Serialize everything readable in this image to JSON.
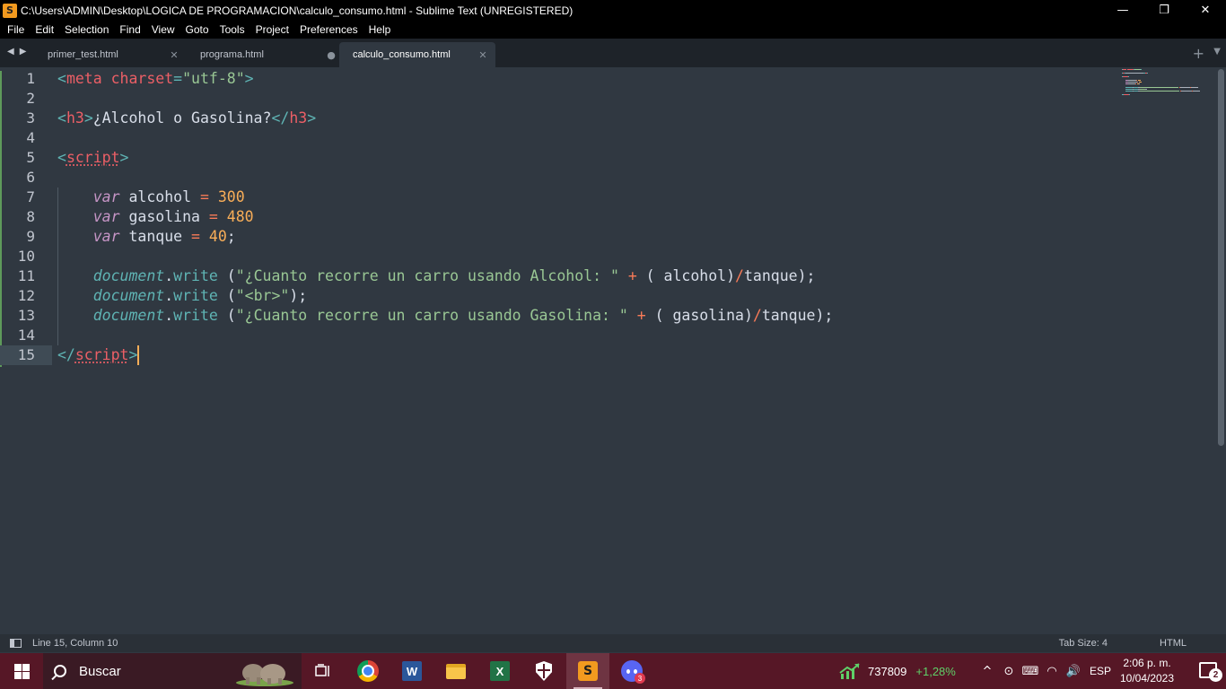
{
  "window": {
    "title": "C:\\Users\\ADMIN\\Desktop\\LOGICA DE PROGRAMACION\\calculo_consumo.html - Sublime Text (UNREGISTERED)",
    "controls": {
      "minimize": "—",
      "maximize": "❐",
      "close": "✕"
    }
  },
  "menu": [
    "File",
    "Edit",
    "Selection",
    "Find",
    "View",
    "Goto",
    "Tools",
    "Project",
    "Preferences",
    "Help"
  ],
  "tabs": [
    {
      "label": "primer_test.html",
      "state": "close"
    },
    {
      "label": "programa.html",
      "state": "modified"
    },
    {
      "label": "calculo_consumo.html",
      "state": "active"
    }
  ],
  "tabbar": {
    "back": "◀",
    "forward": "▶",
    "new_tab": "+",
    "more": "▼"
  },
  "tab_controls": {
    "close": "✕",
    "modified": "●"
  },
  "editor": {
    "line_numbers": [
      "1",
      "2",
      "3",
      "4",
      "5",
      "6",
      "7",
      "8",
      "9",
      "10",
      "11",
      "12",
      "13",
      "14",
      "15"
    ],
    "current_line": 15,
    "lines": [
      [
        [
          "tk-punc",
          "<"
        ],
        [
          "tk-tag",
          "meta"
        ],
        [
          "tk-text",
          " "
        ],
        [
          "tk-attr",
          "charset"
        ],
        [
          "tk-punc",
          "="
        ],
        [
          "tk-str",
          "\"utf-8\""
        ],
        [
          "tk-punc",
          ">"
        ]
      ],
      [],
      [
        [
          "tk-punc",
          "<"
        ],
        [
          "tk-tag",
          "h3"
        ],
        [
          "tk-punc",
          ">"
        ],
        [
          "tk-text",
          "¿Alcohol o Gasolina?"
        ],
        [
          "tk-punc",
          "</"
        ],
        [
          "tk-tag",
          "h3"
        ],
        [
          "tk-punc",
          ">"
        ]
      ],
      [],
      [
        [
          "tk-punc",
          "<"
        ],
        [
          "tk-tag ul",
          "script"
        ],
        [
          "tk-punc",
          ">"
        ]
      ],
      [],
      [
        [
          "tk-text",
          "    "
        ],
        [
          "tk-kw",
          "var"
        ],
        [
          "tk-text",
          " alcohol "
        ],
        [
          "tk-op",
          "="
        ],
        [
          "tk-text",
          " "
        ],
        [
          "tk-num",
          "300"
        ]
      ],
      [
        [
          "tk-text",
          "    "
        ],
        [
          "tk-kw",
          "var"
        ],
        [
          "tk-text",
          " gasolina "
        ],
        [
          "tk-op",
          "="
        ],
        [
          "tk-text",
          " "
        ],
        [
          "tk-num",
          "480"
        ]
      ],
      [
        [
          "tk-text",
          "    "
        ],
        [
          "tk-kw",
          "var"
        ],
        [
          "tk-text",
          " tanque "
        ],
        [
          "tk-op",
          "="
        ],
        [
          "tk-text",
          " "
        ],
        [
          "tk-num",
          "40"
        ],
        [
          "tk-text",
          ";"
        ]
      ],
      [],
      [
        [
          "tk-text",
          "    "
        ],
        [
          "tk-doc",
          "document"
        ],
        [
          "tk-text",
          "."
        ],
        [
          "tk-method",
          "write"
        ],
        [
          "tk-text",
          " ("
        ],
        [
          "tk-str",
          "\"¿Cuanto recorre un carro usando Alcohol: \""
        ],
        [
          "tk-text",
          " "
        ],
        [
          "tk-op",
          "+"
        ],
        [
          "tk-text",
          " ( alcohol)"
        ],
        [
          "tk-op",
          "/"
        ],
        [
          "tk-text",
          "tanque);"
        ]
      ],
      [
        [
          "tk-text",
          "    "
        ],
        [
          "tk-doc",
          "document"
        ],
        [
          "tk-text",
          "."
        ],
        [
          "tk-method",
          "write"
        ],
        [
          "tk-text",
          " ("
        ],
        [
          "tk-str",
          "\"<br>\""
        ],
        [
          "tk-text",
          ");"
        ]
      ],
      [
        [
          "tk-text",
          "    "
        ],
        [
          "tk-doc",
          "document"
        ],
        [
          "tk-text",
          "."
        ],
        [
          "tk-method",
          "write"
        ],
        [
          "tk-text",
          " ("
        ],
        [
          "tk-str",
          "\"¿Cuanto recorre un carro usando Gasolina: \""
        ],
        [
          "tk-text",
          " "
        ],
        [
          "tk-op",
          "+"
        ],
        [
          "tk-text",
          " ( gasolina)"
        ],
        [
          "tk-op",
          "/"
        ],
        [
          "tk-text",
          "tanque);"
        ]
      ],
      [],
      [
        [
          "tk-punc",
          "</"
        ],
        [
          "tk-tag ul",
          "script"
        ],
        [
          "tk-punc",
          ">"
        ]
      ]
    ]
  },
  "status": {
    "position": "Line 15, Column 10",
    "tab_size": "Tab Size: 4",
    "syntax": "HTML"
  },
  "taskbar": {
    "search_placeholder": "Buscar",
    "apps": [
      "task-view",
      "chrome",
      "word",
      "file-explorer",
      "excel",
      "security",
      "sublime-text",
      "discord"
    ],
    "discord_badge": "3",
    "word_letter": "W",
    "excel_letter": "X",
    "sublime_letter": "S",
    "stock_value": "737809",
    "stock_change": "+1,28%",
    "tray_icons": {
      "chevron": "^",
      "meet": "⊙",
      "ime": "⌨",
      "wifi": "◠",
      "volume": "🔊"
    },
    "language": "ESP",
    "time": "2:06 p. m.",
    "date": "10/04/2023",
    "notifications": "2"
  },
  "colors": {
    "editor_bg": "#303841",
    "tab_bar_bg": "#1e2329",
    "taskbar_bg": "#561726",
    "caret": "#f9ae58"
  }
}
